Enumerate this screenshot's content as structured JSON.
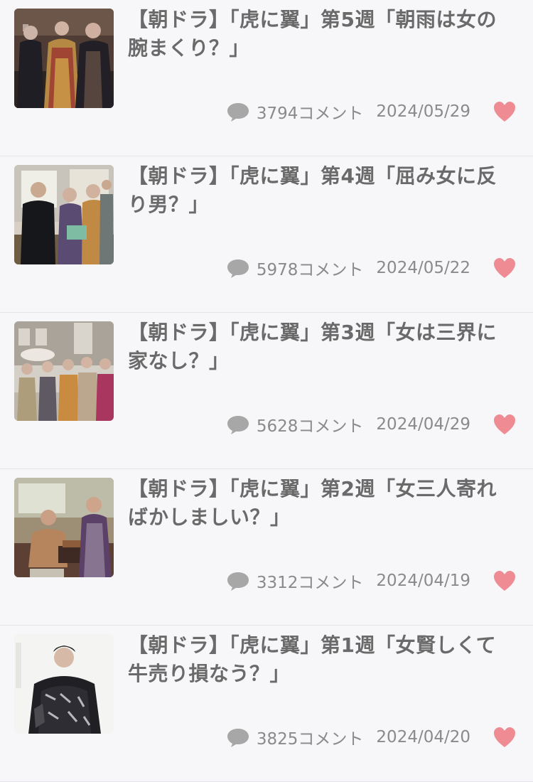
{
  "articles": [
    {
      "title": "【朝ドラ】「虎に翼」第5週「朝雨は女の腕まくり？」",
      "comment_count": "3794コメント",
      "date": "2024/05/29",
      "thumbnail_icon": "drama-still-image"
    },
    {
      "title": "【朝ドラ】「虎に翼」第4週「屈み女に反り男？」",
      "comment_count": "5978コメント",
      "date": "2024/05/22",
      "thumbnail_icon": "drama-still-image"
    },
    {
      "title": "【朝ドラ】「虎に翼」第3週「女は三界に家なし？」",
      "comment_count": "5628コメント",
      "date": "2024/04/29",
      "thumbnail_icon": "drama-still-image"
    },
    {
      "title": "【朝ドラ】「虎に翼」第2週「女三人寄ればかしましい？」",
      "comment_count": "3312コメント",
      "date": "2024/04/19",
      "thumbnail_icon": "drama-still-image"
    },
    {
      "title": "【朝ドラ】「虎に翼」第1週「女賢しくて牛売り損なう？」",
      "comment_count": "3825コメント",
      "date": "2024/04/20",
      "thumbnail_icon": "drama-poster-image"
    }
  ],
  "icons": {
    "comment": "comment-icon",
    "like": "heart-icon"
  },
  "colors": {
    "title_text": "#6a6a6a",
    "meta_text": "#8a8a8a",
    "heart": "#ef8b92",
    "comment_icon": "#a7a7a7",
    "background": "#f7f7f9",
    "divider": "#e4e4e8"
  }
}
